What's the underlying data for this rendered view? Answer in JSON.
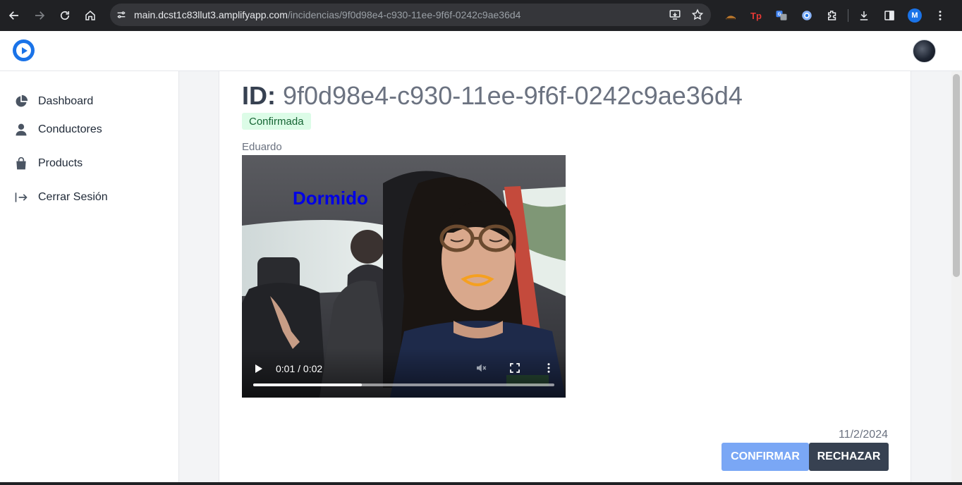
{
  "browser": {
    "url_host": "main.dcst1c83llut3.amplifyapp.com",
    "url_path": "/incidencias/9f0d98e4-c930-11ee-9f6f-0242c9ae36d4",
    "profile_initial": "M",
    "extension_tp_label": "Tp"
  },
  "sidebar": {
    "items": [
      {
        "label": "Dashboard",
        "icon": "pie-chart-icon"
      },
      {
        "label": "Conductores",
        "icon": "user-icon"
      },
      {
        "label": "Products",
        "icon": "shopping-bag-icon"
      },
      {
        "label": "Cerrar Sesión",
        "icon": "sign-out-icon"
      }
    ]
  },
  "incident": {
    "id_label": "ID:",
    "id_value": "9f0d98e4-c930-11ee-9f6f-0242c9ae36d4",
    "status": "Confirmada",
    "driver": "Eduardo",
    "video_overlay": "Dormido",
    "video_time": "0:01 / 0:02",
    "video_progress": 0.36,
    "date": "11/2/2024"
  },
  "actions": {
    "confirm_label": "CONFIRMAR",
    "reject_label": "RECHAZAR"
  },
  "colors": {
    "status_bg": "#dcfce7",
    "status_text": "#166534",
    "confirm_bg": "#7aa7f5",
    "reject_bg": "#374151",
    "overlay_text": "#0000e6"
  }
}
